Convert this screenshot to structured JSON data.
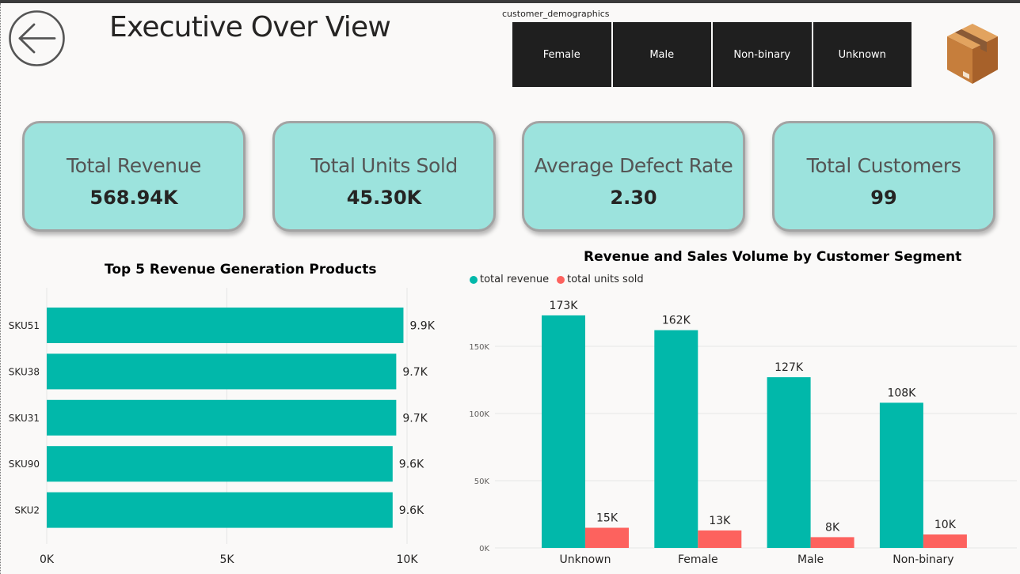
{
  "page": {
    "title": "Executive Over View"
  },
  "slicer": {
    "title": "customer_demographics",
    "options": [
      "Female",
      "Male",
      "Non-binary",
      "Unknown"
    ]
  },
  "icons": {
    "back": "arrow-left-circle-icon",
    "logo": "package-box-icon"
  },
  "kpis": [
    {
      "label": "Total Revenue",
      "value": "568.94K"
    },
    {
      "label": "Total Units Sold",
      "value": "45.30K"
    },
    {
      "label": "Average Defect Rate",
      "value": "2.30"
    },
    {
      "label": "Total Customers",
      "value": "99"
    }
  ],
  "colors": {
    "kpi_fill": "#9ce3dd",
    "revenue": "#01b8aa",
    "units": "#fd625e",
    "slicer": "#1f1f1f"
  },
  "chart_data": [
    {
      "type": "bar",
      "orientation": "horizontal",
      "title": "Top 5 Revenue Generation Products",
      "categories": [
        "SKU51",
        "SKU38",
        "SKU31",
        "SKU90",
        "SKU2"
      ],
      "values": [
        9900,
        9700,
        9700,
        9600,
        9600
      ],
      "data_labels": [
        "9.9K",
        "9.7K",
        "9.7K",
        "9.6K",
        "9.6K"
      ],
      "xlim": [
        0,
        10000
      ],
      "x_ticks": [
        0,
        5000,
        10000
      ],
      "x_tick_labels": [
        "0K",
        "5K",
        "10K"
      ],
      "grid": true
    },
    {
      "type": "bar",
      "title": "Revenue and Sales Volume by Customer Segment",
      "categories": [
        "Unknown",
        "Female",
        "Male",
        "Non-binary"
      ],
      "series": [
        {
          "name": "total revenue",
          "values": [
            173000,
            162000,
            127000,
            108000
          ],
          "labels": [
            "173K",
            "162K",
            "127K",
            "108K"
          ]
        },
        {
          "name": "total units sold",
          "values": [
            15000,
            13000,
            8000,
            10000
          ],
          "labels": [
            "15K",
            "13K",
            "8K",
            "10K"
          ]
        }
      ],
      "ylim": [
        0,
        180000
      ],
      "y_ticks": [
        0,
        50000,
        100000,
        150000
      ],
      "y_tick_labels": [
        "0K",
        "50K",
        "100K",
        "150K"
      ],
      "legend": "top-left",
      "grid": true
    }
  ]
}
